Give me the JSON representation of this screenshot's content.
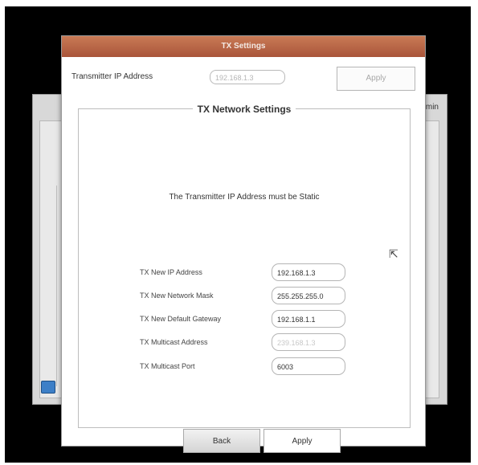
{
  "background": {
    "admin_text": "dmin"
  },
  "dialog": {
    "title": "TX Settings",
    "transmitter_label": "Transmitter IP Address",
    "transmitter_value": "192.168.1.3",
    "apply_top": "Apply",
    "section_title": "TX Network Settings",
    "notice": "The Transmitter IP Address must be Static",
    "fields": [
      {
        "label": "TX New IP Address",
        "value": "192.168.1.3"
      },
      {
        "label": "TX New Network Mask",
        "value": "255.255.255.0"
      },
      {
        "label": "TX New Default Gateway",
        "value": "192.168.1.1"
      },
      {
        "label": "TX Multicast Address",
        "value": "239.168.1.3"
      },
      {
        "label": "TX Multicast Port",
        "value": "6003"
      }
    ],
    "back_button": "Back",
    "apply_button": "Apply"
  }
}
